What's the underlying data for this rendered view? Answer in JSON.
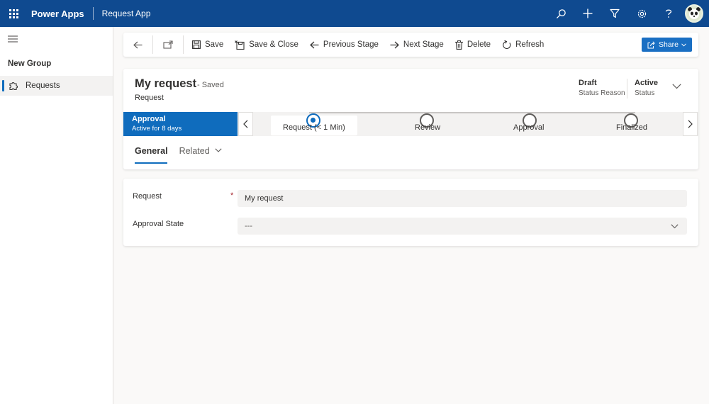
{
  "topbar": {
    "app_name": "Power Apps",
    "app_title": "Request App",
    "icons": [
      "search-icon",
      "add-icon",
      "filter-icon",
      "settings-icon",
      "help-icon"
    ]
  },
  "sidebar": {
    "group_label": "New Group",
    "items": [
      {
        "label": "Requests",
        "icon": "puzzle-icon",
        "selected": true
      }
    ]
  },
  "commands": {
    "back": "back-icon",
    "open_new": "open-in-new-window-icon",
    "save": "Save",
    "save_close": "Save & Close",
    "previous_stage": "Previous Stage",
    "next_stage": "Next Stage",
    "delete": "Delete",
    "refresh": "Refresh",
    "share": "Share"
  },
  "record": {
    "title": "My request",
    "saved_status": "- Saved",
    "entity": "Request",
    "status_reason_value": "Draft",
    "status_reason_label": "Status Reason",
    "status_value": "Active",
    "status_label": "Status"
  },
  "process": {
    "active_stage_name": "Approval",
    "active_stage_duration": "Active for 8 days",
    "stages": [
      {
        "name": "Request  (< 1 Min)",
        "active": true
      },
      {
        "name": "Review",
        "active": false
      },
      {
        "name": "Approval",
        "active": false
      },
      {
        "name": "Finalized",
        "active": false
      }
    ]
  },
  "tabs": [
    {
      "label": "General",
      "selected": true
    },
    {
      "label": "Related",
      "selected": false
    }
  ],
  "form": {
    "request_label": "Request",
    "request_required_marker": "*",
    "request_value": "My request",
    "approval_state_label": "Approval State",
    "approval_state_value": "---"
  },
  "colors": {
    "topbar": "#0f4a90",
    "accent": "#0f6cbd",
    "share_button": "#1a6fc3"
  }
}
